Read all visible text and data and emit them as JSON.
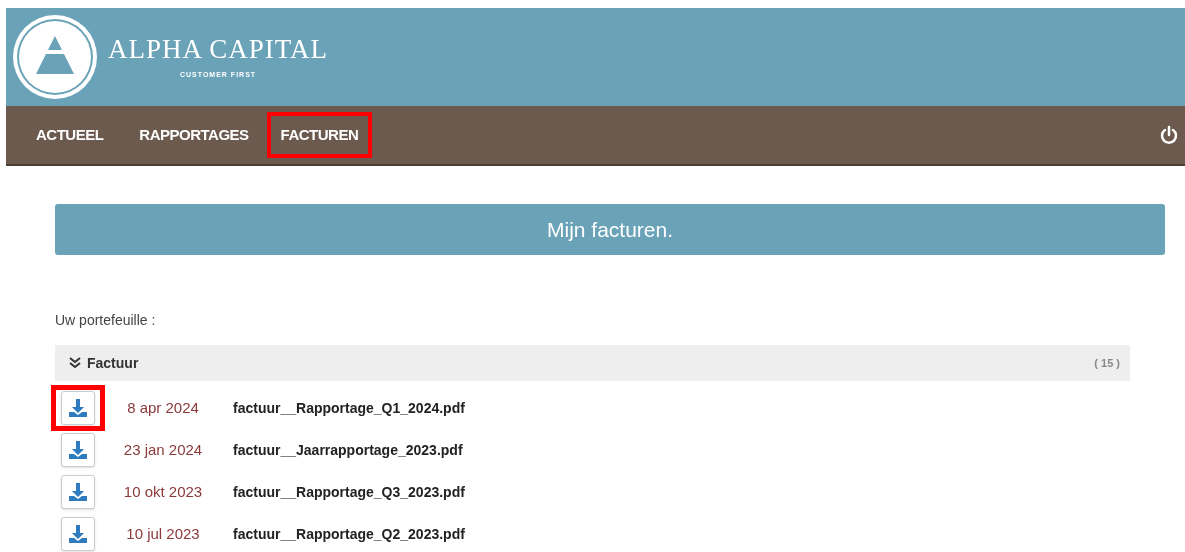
{
  "brand": {
    "name": "ALPHA CAPITAL",
    "tagline": "CUSTOMER FIRST"
  },
  "nav": [
    {
      "label": "ACTUEEL",
      "highlighted": false
    },
    {
      "label": "RAPPORTAGES",
      "highlighted": false
    },
    {
      "label": "FACTUREN",
      "highlighted": true
    }
  ],
  "banner": "Mijn facturen.",
  "portfolio_label": "Uw portefeuille :",
  "group": {
    "title": "Factuur",
    "expanded": true,
    "count": "( 15 )"
  },
  "rows": [
    {
      "date": "8 apr 2024",
      "file": "factuur__Rapportage_Q1_2024.pdf",
      "highlighted": true
    },
    {
      "date": "23 jan 2024",
      "file": "factuur__Jaarrapportage_2023.pdf",
      "highlighted": false
    },
    {
      "date": "10 okt 2023",
      "file": "factuur__Rapportage_Q3_2023.pdf",
      "highlighted": false
    },
    {
      "date": "10 jul 2023",
      "file": "factuur__Rapportage_Q2_2023.pdf",
      "highlighted": false
    }
  ]
}
